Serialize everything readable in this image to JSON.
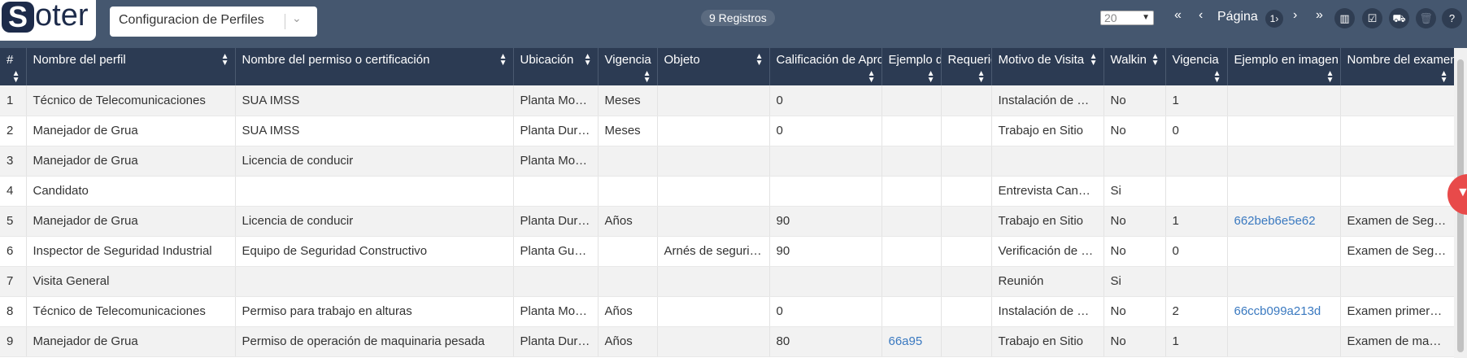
{
  "app": {
    "logo_letter": "S",
    "logo_rest": "oter"
  },
  "profile_select": {
    "value": "Configuracion de Perfiles"
  },
  "records_badge": "9 Registros",
  "pagination": {
    "page_size": "20",
    "first": "«",
    "prev": "‹",
    "label": "Página",
    "current": "1›",
    "next": "›",
    "last": "»"
  },
  "toolbar_icons": {
    "columns": "▥",
    "check": "☑",
    "road": "⛟",
    "delete": "🗑",
    "help": "?"
  },
  "table": {
    "headers": [
      "#",
      "Nombre del perfil",
      "Nombre del permiso o certificación",
      "Ubicación",
      "Vigencia",
      "Objeto",
      "Calificación de Aprobación",
      "Ejemplo de",
      "Requerido",
      "Motivo de Visita",
      "Walkin",
      "Vigencia",
      "Ejemplo en imagen",
      "Nombre del examen"
    ],
    "rows": [
      [
        "1",
        "Técnico de Telecomunicaciones",
        "SUA IMSS",
        "Planta Monterrey",
        "Meses",
        "",
        "0",
        "",
        "",
        "Instalación de Red",
        "No",
        "1",
        "",
        ""
      ],
      [
        "2",
        "Manejador de Grua",
        "SUA IMSS",
        "Planta Durango",
        "Meses",
        "",
        "0",
        "",
        "",
        "Trabajo en Sitio",
        "No",
        "0",
        "",
        ""
      ],
      [
        "3",
        "Manejador de Grua",
        "Licencia de conducir",
        "Planta Monterrey",
        "",
        "",
        "",
        "",
        "",
        "",
        "",
        "",
        "",
        ""
      ],
      [
        "4",
        "Candidato",
        "",
        "",
        "",
        "",
        "",
        "",
        "",
        "Entrevista Candidato",
        "Si",
        "",
        "",
        ""
      ],
      [
        "5",
        "Manejador de Grua",
        "Licencia de conducir",
        "Planta Durango",
        "Años",
        "",
        "90",
        "",
        "",
        "Trabajo en Sitio",
        "No",
        "1",
        "662beb6e5e62",
        "Examen de Seguridad"
      ],
      [
        "6",
        "Inspector de Seguridad Industrial",
        "Equipo de Seguridad Constructivo",
        "Planta Guadalajara",
        "",
        "Arnés de seguridad",
        "90",
        "",
        "",
        "Verificación de equipo",
        "No",
        "0",
        "",
        "Examen de Seguridad"
      ],
      [
        "7",
        "Visita General",
        "",
        "",
        "",
        "",
        "",
        "",
        "",
        "Reunión",
        "Si",
        "",
        "",
        ""
      ],
      [
        "8",
        "Técnico de Telecomunicaciones",
        "Permiso para trabajo en alturas",
        "Planta Monterrey",
        "Años",
        "",
        "0",
        "",
        "",
        "Instalación de Red",
        "No",
        "2",
        "66ccb099a213d",
        "Examen primeros auxilios"
      ],
      [
        "9",
        "Manejador de Grua",
        "Permiso de operación de maquinaria pesada",
        "Planta Durango",
        "Años",
        "",
        "80",
        "66a95",
        "",
        "Trabajo en Sitio",
        "No",
        "1",
        "",
        "Examen de manejo"
      ]
    ]
  },
  "filter_button_icon": "filter-icon"
}
